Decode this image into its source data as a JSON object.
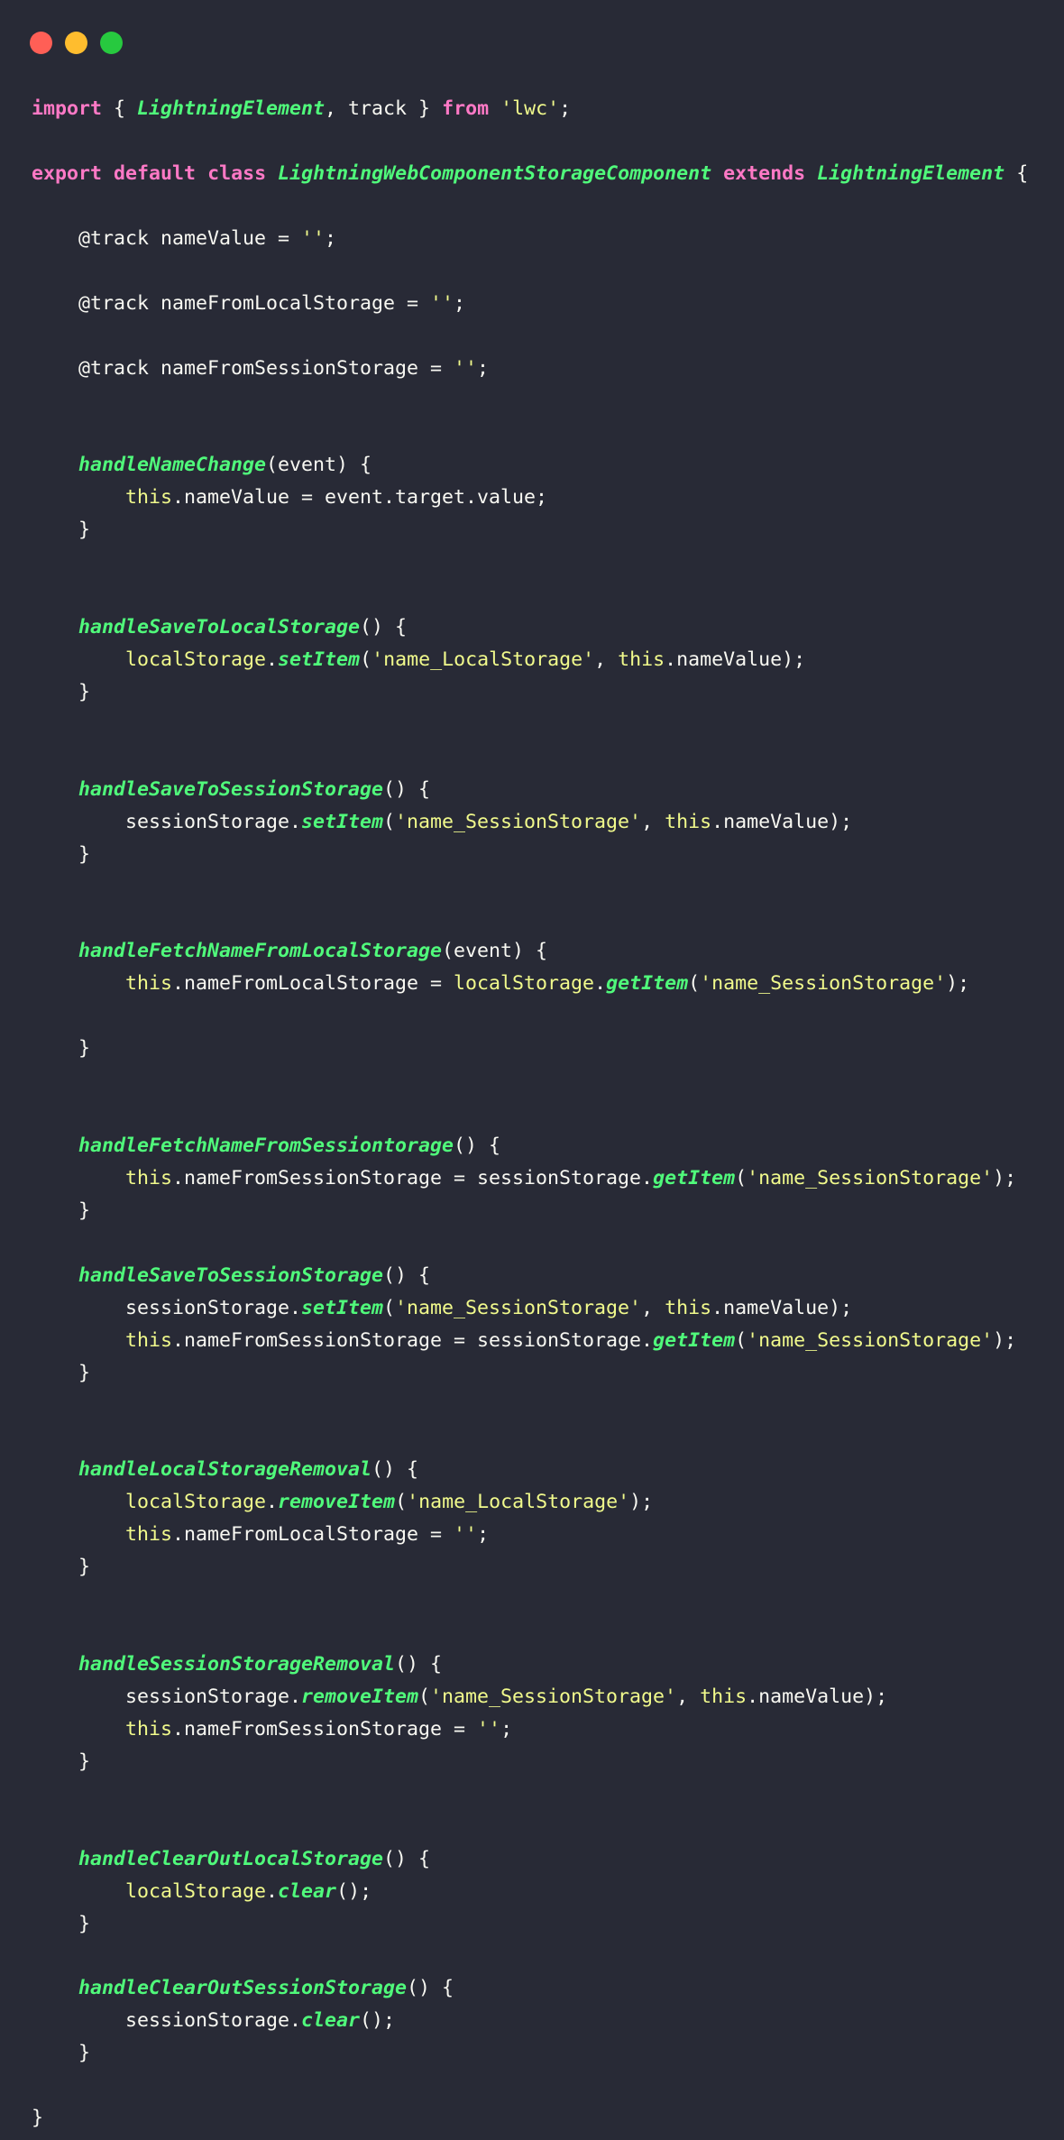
{
  "window": {
    "controls": [
      {
        "name": "close",
        "color": "#ff5f56"
      },
      {
        "name": "minimize",
        "color": "#ffbd2e"
      },
      {
        "name": "maximize",
        "color": "#27c93f"
      }
    ]
  },
  "theme": {
    "background": "#282a36",
    "keyword": "#ff79c6",
    "function": "#50fa7b",
    "string": "#f1fa8c",
    "text": "#f8f8f2"
  },
  "code": {
    "language": "javascript",
    "lines": [
      [
        [
          "kw",
          "import"
        ],
        [
          "plain",
          " { "
        ],
        [
          "cls",
          "LightningElement"
        ],
        [
          "plain",
          ", track } "
        ],
        [
          "kw",
          "from"
        ],
        [
          "plain",
          " "
        ],
        [
          "str",
          "'lwc'"
        ],
        [
          "plain",
          ";"
        ]
      ],
      [],
      [
        [
          "kw",
          "export"
        ],
        [
          "plain",
          " "
        ],
        [
          "kw",
          "default"
        ],
        [
          "plain",
          " "
        ],
        [
          "kw",
          "class"
        ],
        [
          "plain",
          " "
        ],
        [
          "cls",
          "LightningWebComponentStorageComponent"
        ],
        [
          "plain",
          " "
        ],
        [
          "kw",
          "extends"
        ],
        [
          "plain",
          " "
        ],
        [
          "cls",
          "LightningElement"
        ],
        [
          "plain",
          " {"
        ]
      ],
      [],
      [
        [
          "plain",
          "    @track nameValue = "
        ],
        [
          "str",
          "''"
        ],
        [
          "plain",
          ";"
        ]
      ],
      [],
      [
        [
          "plain",
          "    @track nameFromLocalStorage = "
        ],
        [
          "str",
          "''"
        ],
        [
          "plain",
          ";"
        ]
      ],
      [],
      [
        [
          "plain",
          "    @track nameFromSessionStorage = "
        ],
        [
          "str",
          "''"
        ],
        [
          "plain",
          ";"
        ]
      ],
      [],
      [],
      [
        [
          "plain",
          "    "
        ],
        [
          "fn",
          "handleNameChange"
        ],
        [
          "plain",
          "(event) {"
        ]
      ],
      [
        [
          "plain",
          "        "
        ],
        [
          "this",
          "this"
        ],
        [
          "plain",
          ".nameValue = event.target.value;"
        ]
      ],
      [
        [
          "plain",
          "    }"
        ]
      ],
      [],
      [],
      [
        [
          "plain",
          "    "
        ],
        [
          "fn",
          "handleSaveToLocalStorage"
        ],
        [
          "plain",
          "() {"
        ]
      ],
      [
        [
          "plain",
          "        "
        ],
        [
          "this",
          "localStorage"
        ],
        [
          "plain",
          "."
        ],
        [
          "fn",
          "setItem"
        ],
        [
          "plain",
          "("
        ],
        [
          "str",
          "'name_LocalStorage'"
        ],
        [
          "plain",
          ", "
        ],
        [
          "this",
          "this"
        ],
        [
          "plain",
          ".nameValue);"
        ]
      ],
      [
        [
          "plain",
          "    }"
        ]
      ],
      [],
      [],
      [
        [
          "plain",
          "    "
        ],
        [
          "fn",
          "handleSaveToSessionStorage"
        ],
        [
          "plain",
          "() {"
        ]
      ],
      [
        [
          "plain",
          "        sessionStorage."
        ],
        [
          "fn",
          "setItem"
        ],
        [
          "plain",
          "("
        ],
        [
          "str",
          "'name_SessionStorage'"
        ],
        [
          "plain",
          ", "
        ],
        [
          "this",
          "this"
        ],
        [
          "plain",
          ".nameValue);"
        ]
      ],
      [
        [
          "plain",
          "    }"
        ]
      ],
      [],
      [],
      [
        [
          "plain",
          "    "
        ],
        [
          "fn",
          "handleFetchNameFromLocalStorage"
        ],
        [
          "plain",
          "(event) {"
        ]
      ],
      [
        [
          "plain",
          "        "
        ],
        [
          "this",
          "this"
        ],
        [
          "plain",
          ".nameFromLocalStorage = "
        ],
        [
          "this",
          "localStorage"
        ],
        [
          "plain",
          "."
        ],
        [
          "fn",
          "getItem"
        ],
        [
          "plain",
          "("
        ],
        [
          "str",
          "'name_SessionStorage'"
        ],
        [
          "plain",
          ");"
        ]
      ],
      [],
      [
        [
          "plain",
          "    }"
        ]
      ],
      [],
      [],
      [
        [
          "plain",
          "    "
        ],
        [
          "fn",
          "handleFetchNameFromSessiontorage"
        ],
        [
          "plain",
          "() {"
        ]
      ],
      [
        [
          "plain",
          "        "
        ],
        [
          "this",
          "this"
        ],
        [
          "plain",
          ".nameFromSessionStorage = sessionStorage."
        ],
        [
          "fn",
          "getItem"
        ],
        [
          "plain",
          "("
        ],
        [
          "str",
          "'name_SessionStorage'"
        ],
        [
          "plain",
          ");"
        ]
      ],
      [
        [
          "plain",
          "    }"
        ]
      ],
      [],
      [
        [
          "plain",
          "    "
        ],
        [
          "fn",
          "handleSaveToSessionStorage"
        ],
        [
          "plain",
          "() {"
        ]
      ],
      [
        [
          "plain",
          "        sessionStorage."
        ],
        [
          "fn",
          "setItem"
        ],
        [
          "plain",
          "("
        ],
        [
          "str",
          "'name_SessionStorage'"
        ],
        [
          "plain",
          ", "
        ],
        [
          "this",
          "this"
        ],
        [
          "plain",
          ".nameValue);"
        ]
      ],
      [
        [
          "plain",
          "        "
        ],
        [
          "this",
          "this"
        ],
        [
          "plain",
          ".nameFromSessionStorage = sessionStorage."
        ],
        [
          "fn",
          "getItem"
        ],
        [
          "plain",
          "("
        ],
        [
          "str",
          "'name_SessionStorage'"
        ],
        [
          "plain",
          ");"
        ]
      ],
      [
        [
          "plain",
          "    }"
        ]
      ],
      [],
      [],
      [
        [
          "plain",
          "    "
        ],
        [
          "fn",
          "handleLocalStorageRemoval"
        ],
        [
          "plain",
          "() {"
        ]
      ],
      [
        [
          "plain",
          "        "
        ],
        [
          "this",
          "localStorage"
        ],
        [
          "plain",
          "."
        ],
        [
          "fn",
          "removeItem"
        ],
        [
          "plain",
          "("
        ],
        [
          "str",
          "'name_LocalStorage'"
        ],
        [
          "plain",
          ");"
        ]
      ],
      [
        [
          "plain",
          "        "
        ],
        [
          "this",
          "this"
        ],
        [
          "plain",
          ".nameFromLocalStorage = "
        ],
        [
          "str",
          "''"
        ],
        [
          "plain",
          ";"
        ]
      ],
      [
        [
          "plain",
          "    }"
        ]
      ],
      [],
      [],
      [
        [
          "plain",
          "    "
        ],
        [
          "fn",
          "handleSessionStorageRemoval"
        ],
        [
          "plain",
          "() {"
        ]
      ],
      [
        [
          "plain",
          "        sessionStorage."
        ],
        [
          "fn",
          "removeItem"
        ],
        [
          "plain",
          "("
        ],
        [
          "str",
          "'name_SessionStorage'"
        ],
        [
          "plain",
          ", "
        ],
        [
          "this",
          "this"
        ],
        [
          "plain",
          ".nameValue);"
        ]
      ],
      [
        [
          "plain",
          "        "
        ],
        [
          "this",
          "this"
        ],
        [
          "plain",
          ".nameFromSessionStorage = "
        ],
        [
          "str",
          "''"
        ],
        [
          "plain",
          ";"
        ]
      ],
      [
        [
          "plain",
          "    }"
        ]
      ],
      [],
      [],
      [
        [
          "plain",
          "    "
        ],
        [
          "fn",
          "handleClearOutLocalStorage"
        ],
        [
          "plain",
          "() {"
        ]
      ],
      [
        [
          "plain",
          "        "
        ],
        [
          "this",
          "localStorage"
        ],
        [
          "plain",
          "."
        ],
        [
          "fn",
          "clear"
        ],
        [
          "plain",
          "();"
        ]
      ],
      [
        [
          "plain",
          "    }"
        ]
      ],
      [],
      [
        [
          "plain",
          "    "
        ],
        [
          "fn",
          "handleClearOutSessionStorage"
        ],
        [
          "plain",
          "() {"
        ]
      ],
      [
        [
          "plain",
          "        sessionStorage."
        ],
        [
          "fn",
          "clear"
        ],
        [
          "plain",
          "();"
        ]
      ],
      [
        [
          "plain",
          "    }"
        ]
      ],
      [],
      [
        [
          "plain",
          "}"
        ]
      ]
    ]
  }
}
